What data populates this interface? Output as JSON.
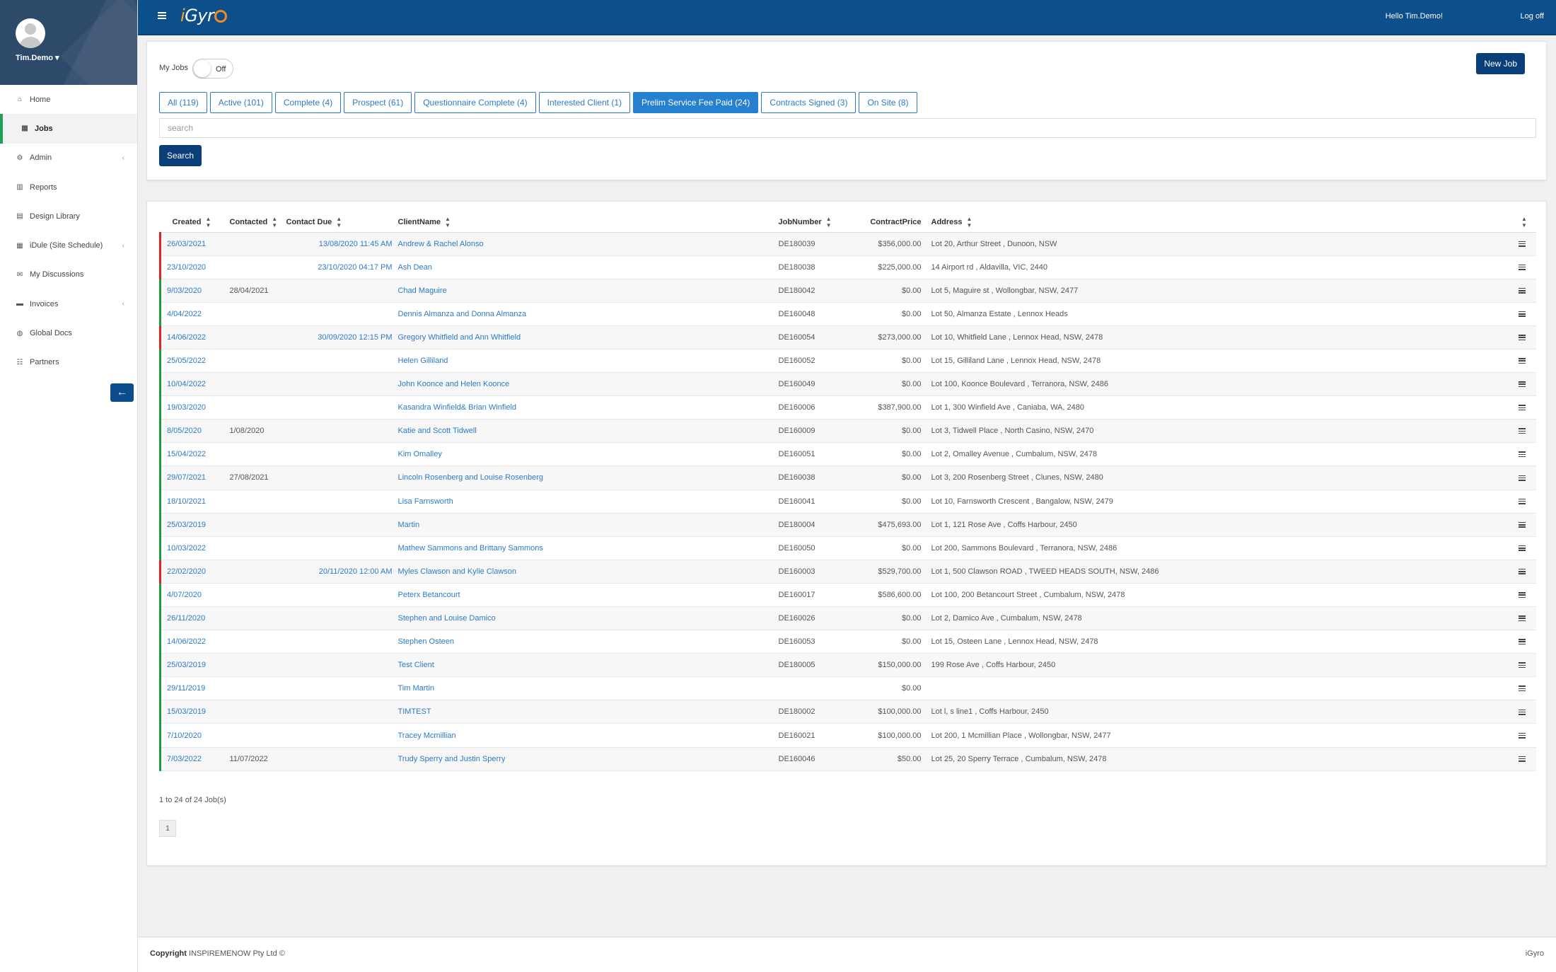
{
  "app": {
    "brand_prefix": "i",
    "brand_suffix": "Gyr",
    "brand_ending": "o"
  },
  "header": {
    "greeting": "Hello Tim.Demo!",
    "logoff": "Log off"
  },
  "user": {
    "name": "Tim.Demo ▾"
  },
  "sidebar": {
    "items": [
      {
        "label": "Home",
        "icon": "home-icon",
        "glyph": "⌂"
      },
      {
        "label": "Jobs",
        "icon": "grid-icon",
        "glyph": "▦"
      },
      {
        "label": "Admin",
        "icon": "gear-icon",
        "glyph": "⚙"
      },
      {
        "label": "Reports",
        "icon": "bar-chart-icon",
        "glyph": "▥"
      },
      {
        "label": "Design Library",
        "icon": "archive-icon",
        "glyph": "▤"
      },
      {
        "label": "iDule (Site Schedule)",
        "icon": "calendar-icon",
        "glyph": "▦"
      },
      {
        "label": "My Discussions",
        "icon": "envelope-icon",
        "glyph": "✉"
      },
      {
        "label": "Invoices",
        "icon": "folder-icon",
        "glyph": "▬"
      },
      {
        "label": "Global Docs",
        "icon": "globe-icon",
        "glyph": "◍"
      },
      {
        "label": "Partners",
        "icon": "users-icon",
        "glyph": "☷"
      }
    ]
  },
  "filters": {
    "my_jobs_label": "My Jobs",
    "toggle_label": "Off",
    "new_job": "New Job",
    "tabs": [
      "All (119)",
      "Active (101)",
      "Complete (4)",
      "Prospect (61)",
      "Questionnaire Complete (4)",
      "Interested Client (1)",
      "Prelim Service Fee Paid (24)",
      "Contracts Signed (3)",
      "On Site (8)"
    ],
    "active_tab": "Prelim Service Fee Paid (24)",
    "search_placeholder": "search",
    "search_button": "Search"
  },
  "table": {
    "headers": {
      "created": "Created",
      "contacted": "Contacted",
      "contact_due": "Contact Due",
      "client": "ClientName",
      "job": "JobNumber",
      "price": "ContractPrice",
      "address": "Address"
    },
    "rows": [
      {
        "created": "26/03/2021",
        "contacted": "",
        "due": "13/08/2020 11:45 AM",
        "client": "Andrew & Rachel Alonso",
        "job": "DE180039",
        "price": "$356,000.00",
        "address": "Lot 20, Arthur Street , Dunoon, NSW",
        "flag": "red"
      },
      {
        "created": "23/10/2020",
        "contacted": "",
        "due": "23/10/2020 04:17 PM",
        "client": "Ash Dean",
        "job": "DE180038",
        "price": "$225,000.00",
        "address": "14 Airport rd , Aldavilla, VIC, 2440",
        "flag": "red"
      },
      {
        "created": "9/03/2020",
        "contacted": "28/04/2021",
        "due": "",
        "client": "Chad Maguire",
        "job": "DE180042",
        "price": "$0.00",
        "address": "Lot 5, Maguire st , Wollongbar, NSW, 2477",
        "flag": "green"
      },
      {
        "created": "4/04/2022",
        "contacted": "",
        "due": "",
        "client": "Dennis Almanza and Donna Almanza",
        "job": "DE160048",
        "price": "$0.00",
        "address": "Lot 50, Almanza Estate , Lennox Heads",
        "flag": "green"
      },
      {
        "created": "14/06/2022",
        "contacted": "",
        "due": "30/09/2020 12:15 PM",
        "client": "Gregory Whitfield and Ann Whitfield",
        "job": "DE160054",
        "price": "$273,000.00",
        "address": "Lot 10, Whitfield Lane , Lennox Head, NSW, 2478",
        "flag": "red"
      },
      {
        "created": "25/05/2022",
        "contacted": "",
        "due": "",
        "client": "Helen Gilliland",
        "job": "DE160052",
        "price": "$0.00",
        "address": "Lot 15, Gilliland Lane , Lennox Head, NSW, 2478",
        "flag": "green"
      },
      {
        "created": "10/04/2022",
        "contacted": "",
        "due": "",
        "client": "John Koonce and Helen Koonce",
        "job": "DE160049",
        "price": "$0.00",
        "address": "Lot 100, Koonce Boulevard , Terranora, NSW, 2486",
        "flag": "green"
      },
      {
        "created": "19/03/2020",
        "contacted": "",
        "due": "",
        "client": "Kasandra Winfield& Brian Winfield",
        "job": "DE160006",
        "price": "$387,900.00",
        "address": "Lot 1, 300 Winfield Ave , Caniaba, WA, 2480",
        "flag": "green"
      },
      {
        "created": "8/05/2020",
        "contacted": "1/08/2020",
        "due": "",
        "client": "Katie and Scott Tidwell",
        "job": "DE160009",
        "price": "$0.00",
        "address": "Lot 3, Tidwell Place , North Casino, NSW, 2470",
        "flag": "green"
      },
      {
        "created": "15/04/2022",
        "contacted": "",
        "due": "",
        "client": "Kim Omalley",
        "job": "DE160051",
        "price": "$0.00",
        "address": "Lot 2, Omalley Avenue , Cumbalum, NSW, 2478",
        "flag": "green"
      },
      {
        "created": "29/07/2021",
        "contacted": "27/08/2021",
        "due": "",
        "client": "Lincoln Rosenberg and Louise Rosenberg",
        "job": "DE160038",
        "price": "$0.00",
        "address": "Lot 3, 200 Rosenberg Street , Clunes, NSW, 2480",
        "flag": "green"
      },
      {
        "created": "18/10/2021",
        "contacted": "",
        "due": "",
        "client": "Lisa Farnsworth",
        "job": "DE160041",
        "price": "$0.00",
        "address": "Lot 10, Farnsworth Crescent , Bangalow, NSW, 2479",
        "flag": "green"
      },
      {
        "created": "25/03/2019",
        "contacted": "",
        "due": "",
        "client": "Martin",
        "job": "DE180004",
        "price": "$475,693.00",
        "address": "Lot 1, 121 Rose Ave , Coffs Harbour, 2450",
        "flag": "green"
      },
      {
        "created": "10/03/2022",
        "contacted": "",
        "due": "",
        "client": "Mathew Sammons and Brittany Sammons",
        "job": "DE160050",
        "price": "$0.00",
        "address": "Lot 200, Sammons Boulevard , Terranora, NSW, 2486",
        "flag": "green"
      },
      {
        "created": "22/02/2020",
        "contacted": "",
        "due": "20/11/2020 12:00 AM",
        "client": "Myles Clawson and Kylie Clawson",
        "job": "DE160003",
        "price": "$529,700.00",
        "address": "Lot 1, 500 Clawson ROAD , TWEED HEADS SOUTH, NSW, 2486",
        "flag": "red"
      },
      {
        "created": "4/07/2020",
        "contacted": "",
        "due": "",
        "client": "Peterx Betancourt",
        "job": "DE160017",
        "price": "$586,600.00",
        "address": "Lot 100, 200 Betancourt Street , Cumbalum, NSW, 2478",
        "flag": "green"
      },
      {
        "created": "26/11/2020",
        "contacted": "",
        "due": "",
        "client": "Stephen and Louise Damico",
        "job": "DE160026",
        "price": "$0.00",
        "address": "Lot 2, Damico Ave , Cumbalum, NSW, 2478",
        "flag": "green"
      },
      {
        "created": "14/06/2022",
        "contacted": "",
        "due": "",
        "client": "Stephen Osteen",
        "job": "DE160053",
        "price": "$0.00",
        "address": "Lot 15, Osteen Lane , Lennox Head, NSW, 2478",
        "flag": "green"
      },
      {
        "created": "25/03/2019",
        "contacted": "",
        "due": "",
        "client": "Test Client",
        "job": "DE180005",
        "price": "$150,000.00",
        "address": "199 Rose Ave , Coffs Harbour, 2450",
        "flag": "green"
      },
      {
        "created": "29/11/2019",
        "contacted": "",
        "due": "",
        "client": "Tim Martin",
        "job": "",
        "price": "$0.00",
        "address": "",
        "flag": "green"
      },
      {
        "created": "15/03/2019",
        "contacted": "",
        "due": "",
        "client": "TIMTEST",
        "job": "DE180002",
        "price": "$100,000.00",
        "address": "Lot l, s line1 , Coffs Harbour, 2450",
        "flag": "green"
      },
      {
        "created": "7/10/2020",
        "contacted": "",
        "due": "",
        "client": "Tracey Mcmillian",
        "job": "DE160021",
        "price": "$100,000.00",
        "address": "Lot 200, 1 Mcmillian Place , Wollongbar, NSW, 2477",
        "flag": "green"
      },
      {
        "created": "7/03/2022",
        "contacted": "11/07/2022",
        "due": "",
        "client": "Trudy Sperry and Justin Sperry",
        "job": "DE160046",
        "price": "$50.00",
        "address": "Lot 25, 20 Sperry Terrace , Cumbalum, NSW, 2478",
        "flag": "green"
      }
    ]
  },
  "pagination": {
    "summary": "1 to 24 of 24 Job(s)",
    "page": "1"
  },
  "footer": {
    "copyright": "Copyright",
    "company": " INSPIREMENOW Pty Ltd ©",
    "brand": "iGyro"
  },
  "colors": {
    "primary": "#0d4f8b",
    "accent": "#2580d0",
    "flag_red": "#e02424",
    "flag_green": "#1e9c3c"
  }
}
